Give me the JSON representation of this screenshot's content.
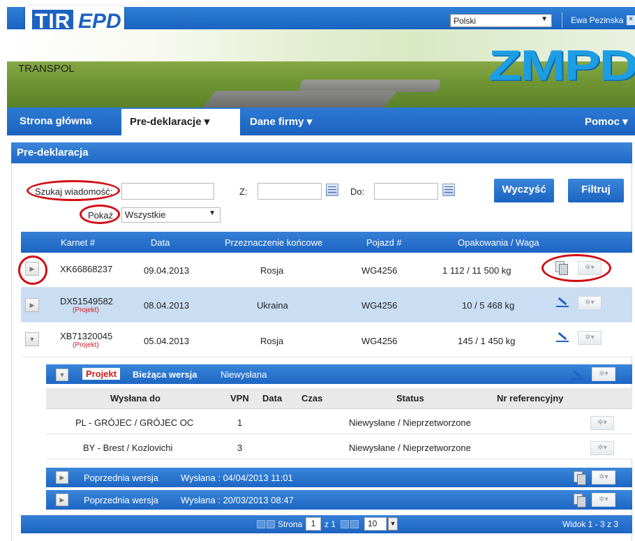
{
  "header": {
    "logo_tir": "TIR",
    "logo_epd": "EPD",
    "language": "Polski",
    "user_name": "Ewa Pezinska",
    "banner_company": "TRANSPOL",
    "banner_brand": "ZMPD"
  },
  "nav": {
    "home": "Strona główna",
    "predeclarations": "Pre-deklaracje ▾",
    "company": "Dane firmy ▾",
    "help": "Pomoc ▾"
  },
  "panel": {
    "title": "Pre-deklaracja"
  },
  "filters": {
    "search_label": "Szukaj wiadomość:",
    "search_value": "",
    "from_label": "Z:",
    "to_label": "Do:",
    "show_label": "Pokaż",
    "show_value": "Wszystkie",
    "clear_button": "Wyczyść",
    "filter_button": "Filtruj"
  },
  "grid": {
    "columns": [
      "Karnet #",
      "Data",
      "Przeznaczenie końcowe",
      "Pojazd #",
      "Opakowania / Waga"
    ],
    "rows": [
      {
        "karnet": "XK66868237",
        "draft": "",
        "date": "09.04.2013",
        "destination": "Rosja",
        "vehicle": "WG4256",
        "packages": "1 112 / 11 500 kg"
      },
      {
        "karnet": "DX51549582",
        "draft": "(Projekt)",
        "date": "08.04.2013",
        "destination": "Ukraina",
        "vehicle": "WG4256",
        "packages": "10 / 5 468 kg"
      },
      {
        "karnet": "XB71320045",
        "draft": "(Projekt)",
        "date": "05.04.2013",
        "destination": "Rosja",
        "vehicle": "WG4256",
        "packages": "145 / 1 450 kg"
      }
    ]
  },
  "detail": {
    "badge": "Projekt",
    "current_version": "Bieżąca wersja",
    "current_status": "Niewysłana",
    "columns": {
      "sent_to": "Wysłana do",
      "vpn": "VPN",
      "date": "Data",
      "time": "Czas",
      "status": "Status",
      "ref": "Nr referencyjny"
    },
    "rows": [
      {
        "sent_to": "PL - GRÓJEC / GRÓJEC OC",
        "vpn": "1",
        "status": "Niewysłane / Nieprzetworzone"
      },
      {
        "sent_to": "BY - Brest / Kozlovichi",
        "vpn": "3",
        "status": "Niewysłane / Nieprzetworzone"
      }
    ],
    "previous": [
      {
        "label": "Poprzednia wersja",
        "sent": "Wysłana : 04/04/2013 11:01"
      },
      {
        "label": "Poprzednia wersja",
        "sent": "Wysłana : 20/03/2013 08:47"
      }
    ]
  },
  "pager": {
    "page_label": "Strona",
    "page_value": "1",
    "of_label": "z 1",
    "page_size": "10",
    "summary": "Widok 1 - 3 z 3"
  },
  "colors": {
    "primary_blue": "#1d64c2",
    "highlight_row": "#c9ddf3",
    "annotation_red": "#d10c12"
  }
}
